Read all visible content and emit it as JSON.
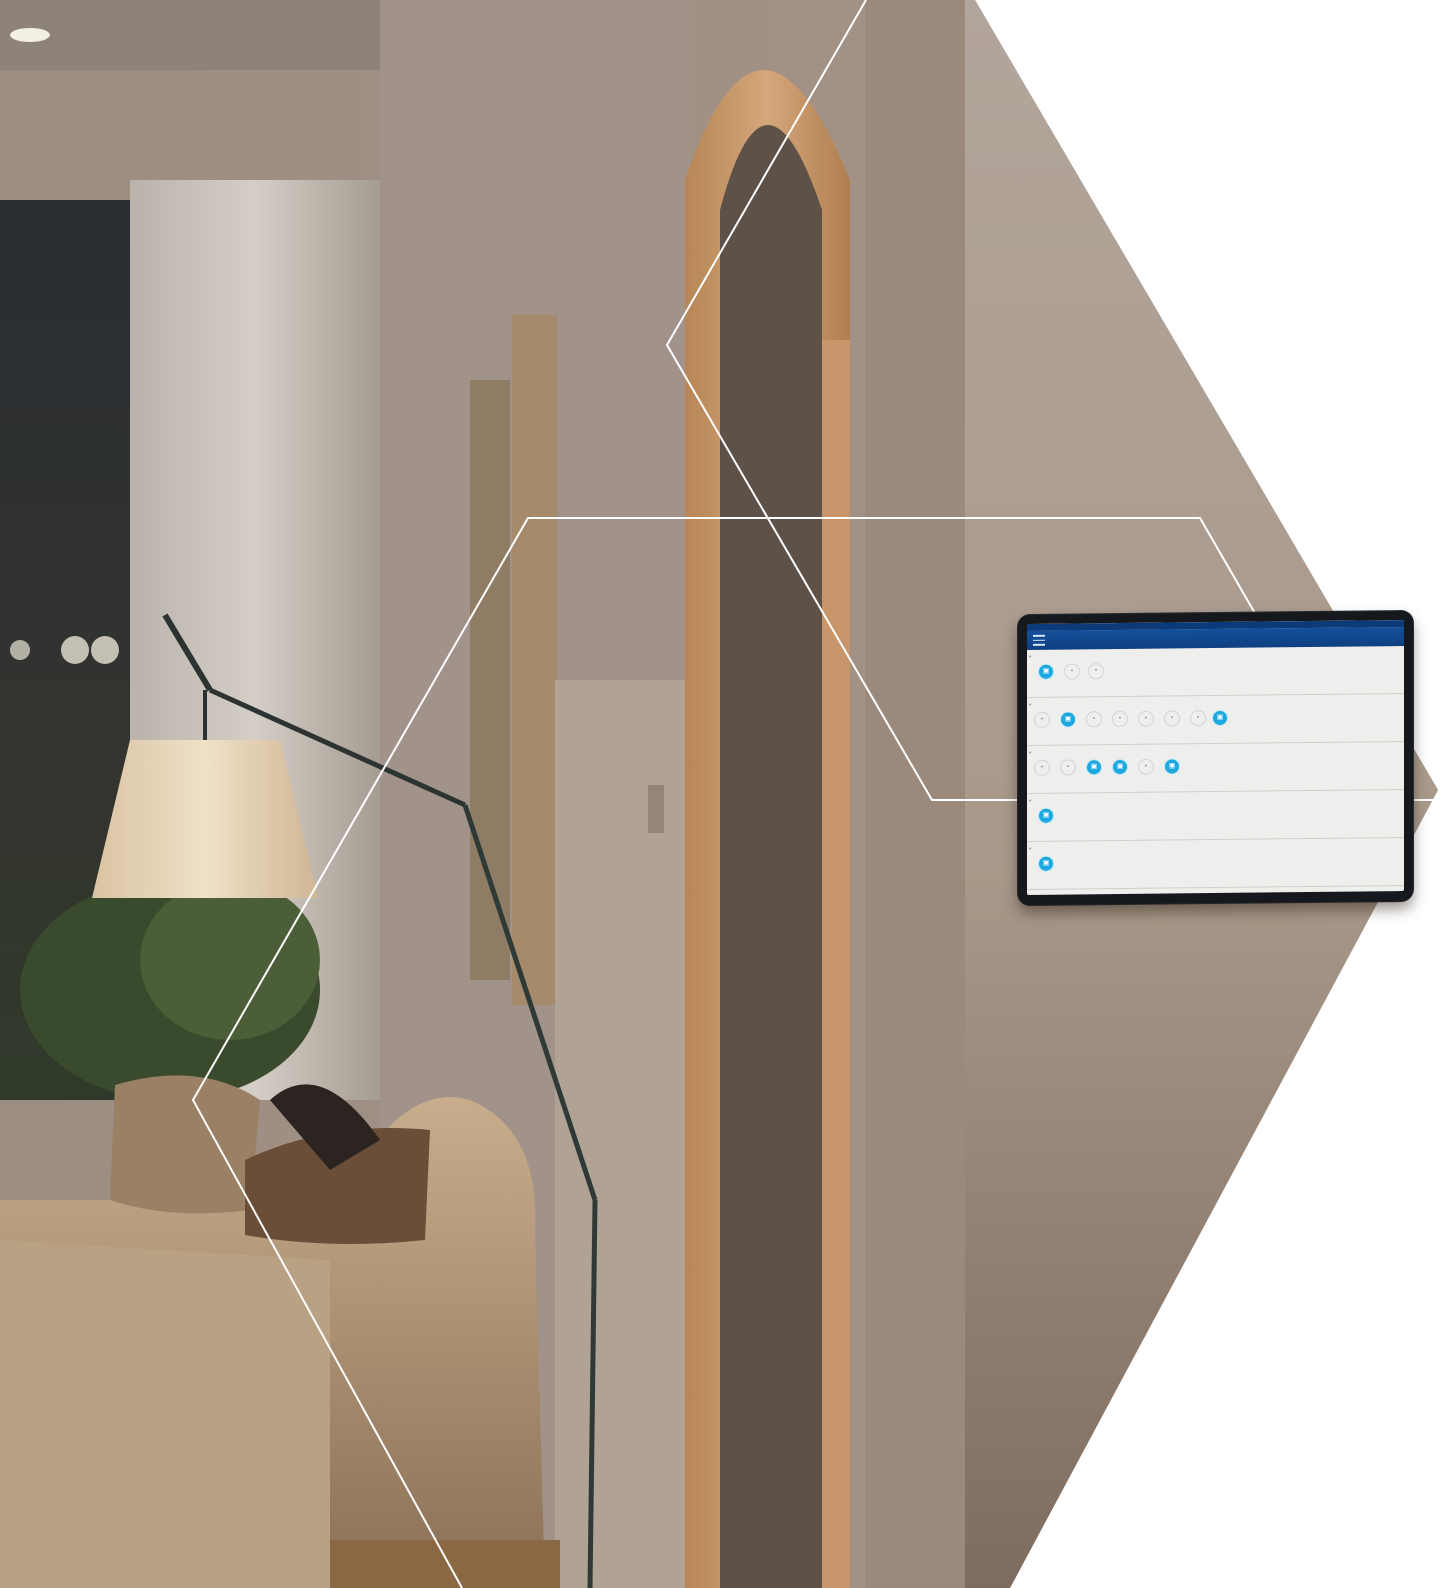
{
  "scene": {
    "description_colors": {
      "wall": "#a8978a",
      "wood": "#c89a6c",
      "lampshade": "#e9d8bd",
      "outline": "#ffffff",
      "accent": "#1da9e0",
      "appbar": "#13509c"
    }
  },
  "tablet": {
    "status_text": "",
    "app_title": "",
    "menu_icon": "hamburger-icon",
    "sections": [
      {
        "title": "",
        "devices": [
          {
            "on": true,
            "label": ""
          },
          {
            "on": false,
            "label": ""
          },
          {
            "on": false,
            "label": ""
          }
        ]
      },
      {
        "title": "",
        "devices": [
          {
            "on": false,
            "label": ""
          },
          {
            "on": true,
            "label": ""
          },
          {
            "on": false,
            "label": ""
          },
          {
            "on": false,
            "label": ""
          },
          {
            "on": false,
            "label": ""
          },
          {
            "on": false,
            "label": ""
          },
          {
            "on": false,
            "label": ""
          },
          {
            "on": true,
            "label": ""
          }
        ]
      },
      {
        "title": "",
        "devices": [
          {
            "on": false,
            "label": ""
          },
          {
            "on": false,
            "label": ""
          },
          {
            "on": true,
            "label": ""
          },
          {
            "on": true,
            "label": ""
          },
          {
            "on": false,
            "label": ""
          },
          {
            "on": true,
            "label": ""
          }
        ]
      },
      {
        "title": "",
        "devices": [
          {
            "on": true,
            "label": ""
          }
        ]
      },
      {
        "title": "",
        "devices": [
          {
            "on": true,
            "label": ""
          }
        ]
      }
    ]
  }
}
